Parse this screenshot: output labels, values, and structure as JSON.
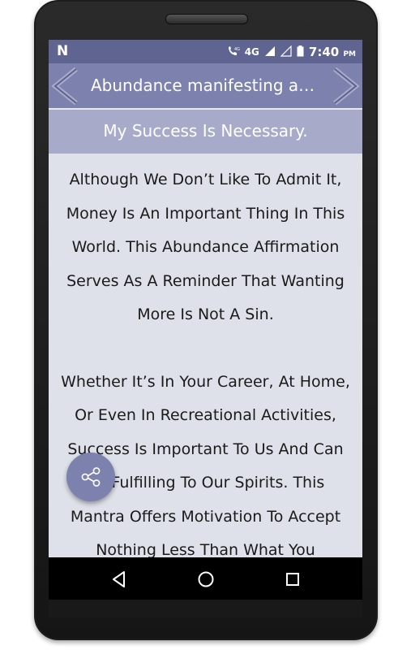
{
  "status_bar": {
    "notification_icon": "n-icon",
    "network_label": "4G",
    "small_network_label": "4G",
    "time": "7:40",
    "ampm": "PM"
  },
  "app_bar": {
    "title": "Abundance manifesting affir...",
    "prev_icon": "chevron-left-icon",
    "next_icon": "chevron-right-icon"
  },
  "affirmation": {
    "title": "My Success Is Necessary.",
    "paragraphs": [
      "Although We Don’t Like To Admit It, Money Is An Important Thing In This World. This Abundance Affirmation Serves As A Reminder That Wanting More Is Not A Sin.",
      "Whether It’s In Your Career, At Home, Or Even In Recreational Activities, Success Is Important To Us And Can Be Fulfilling To Our Spirits. This Mantra Offers Motivation To Accept Nothing Less Than What You"
    ]
  },
  "fab": {
    "icon": "share-icon"
  },
  "nav_bar": {
    "back_icon": "back-icon",
    "home_icon": "home-icon",
    "recents_icon": "recents-icon"
  },
  "colors": {
    "status_bar": "#5f6491",
    "app_bar": "#7c81ad",
    "subtitle_bar": "#a8aac9",
    "content_bg": "#dfe1ea"
  }
}
